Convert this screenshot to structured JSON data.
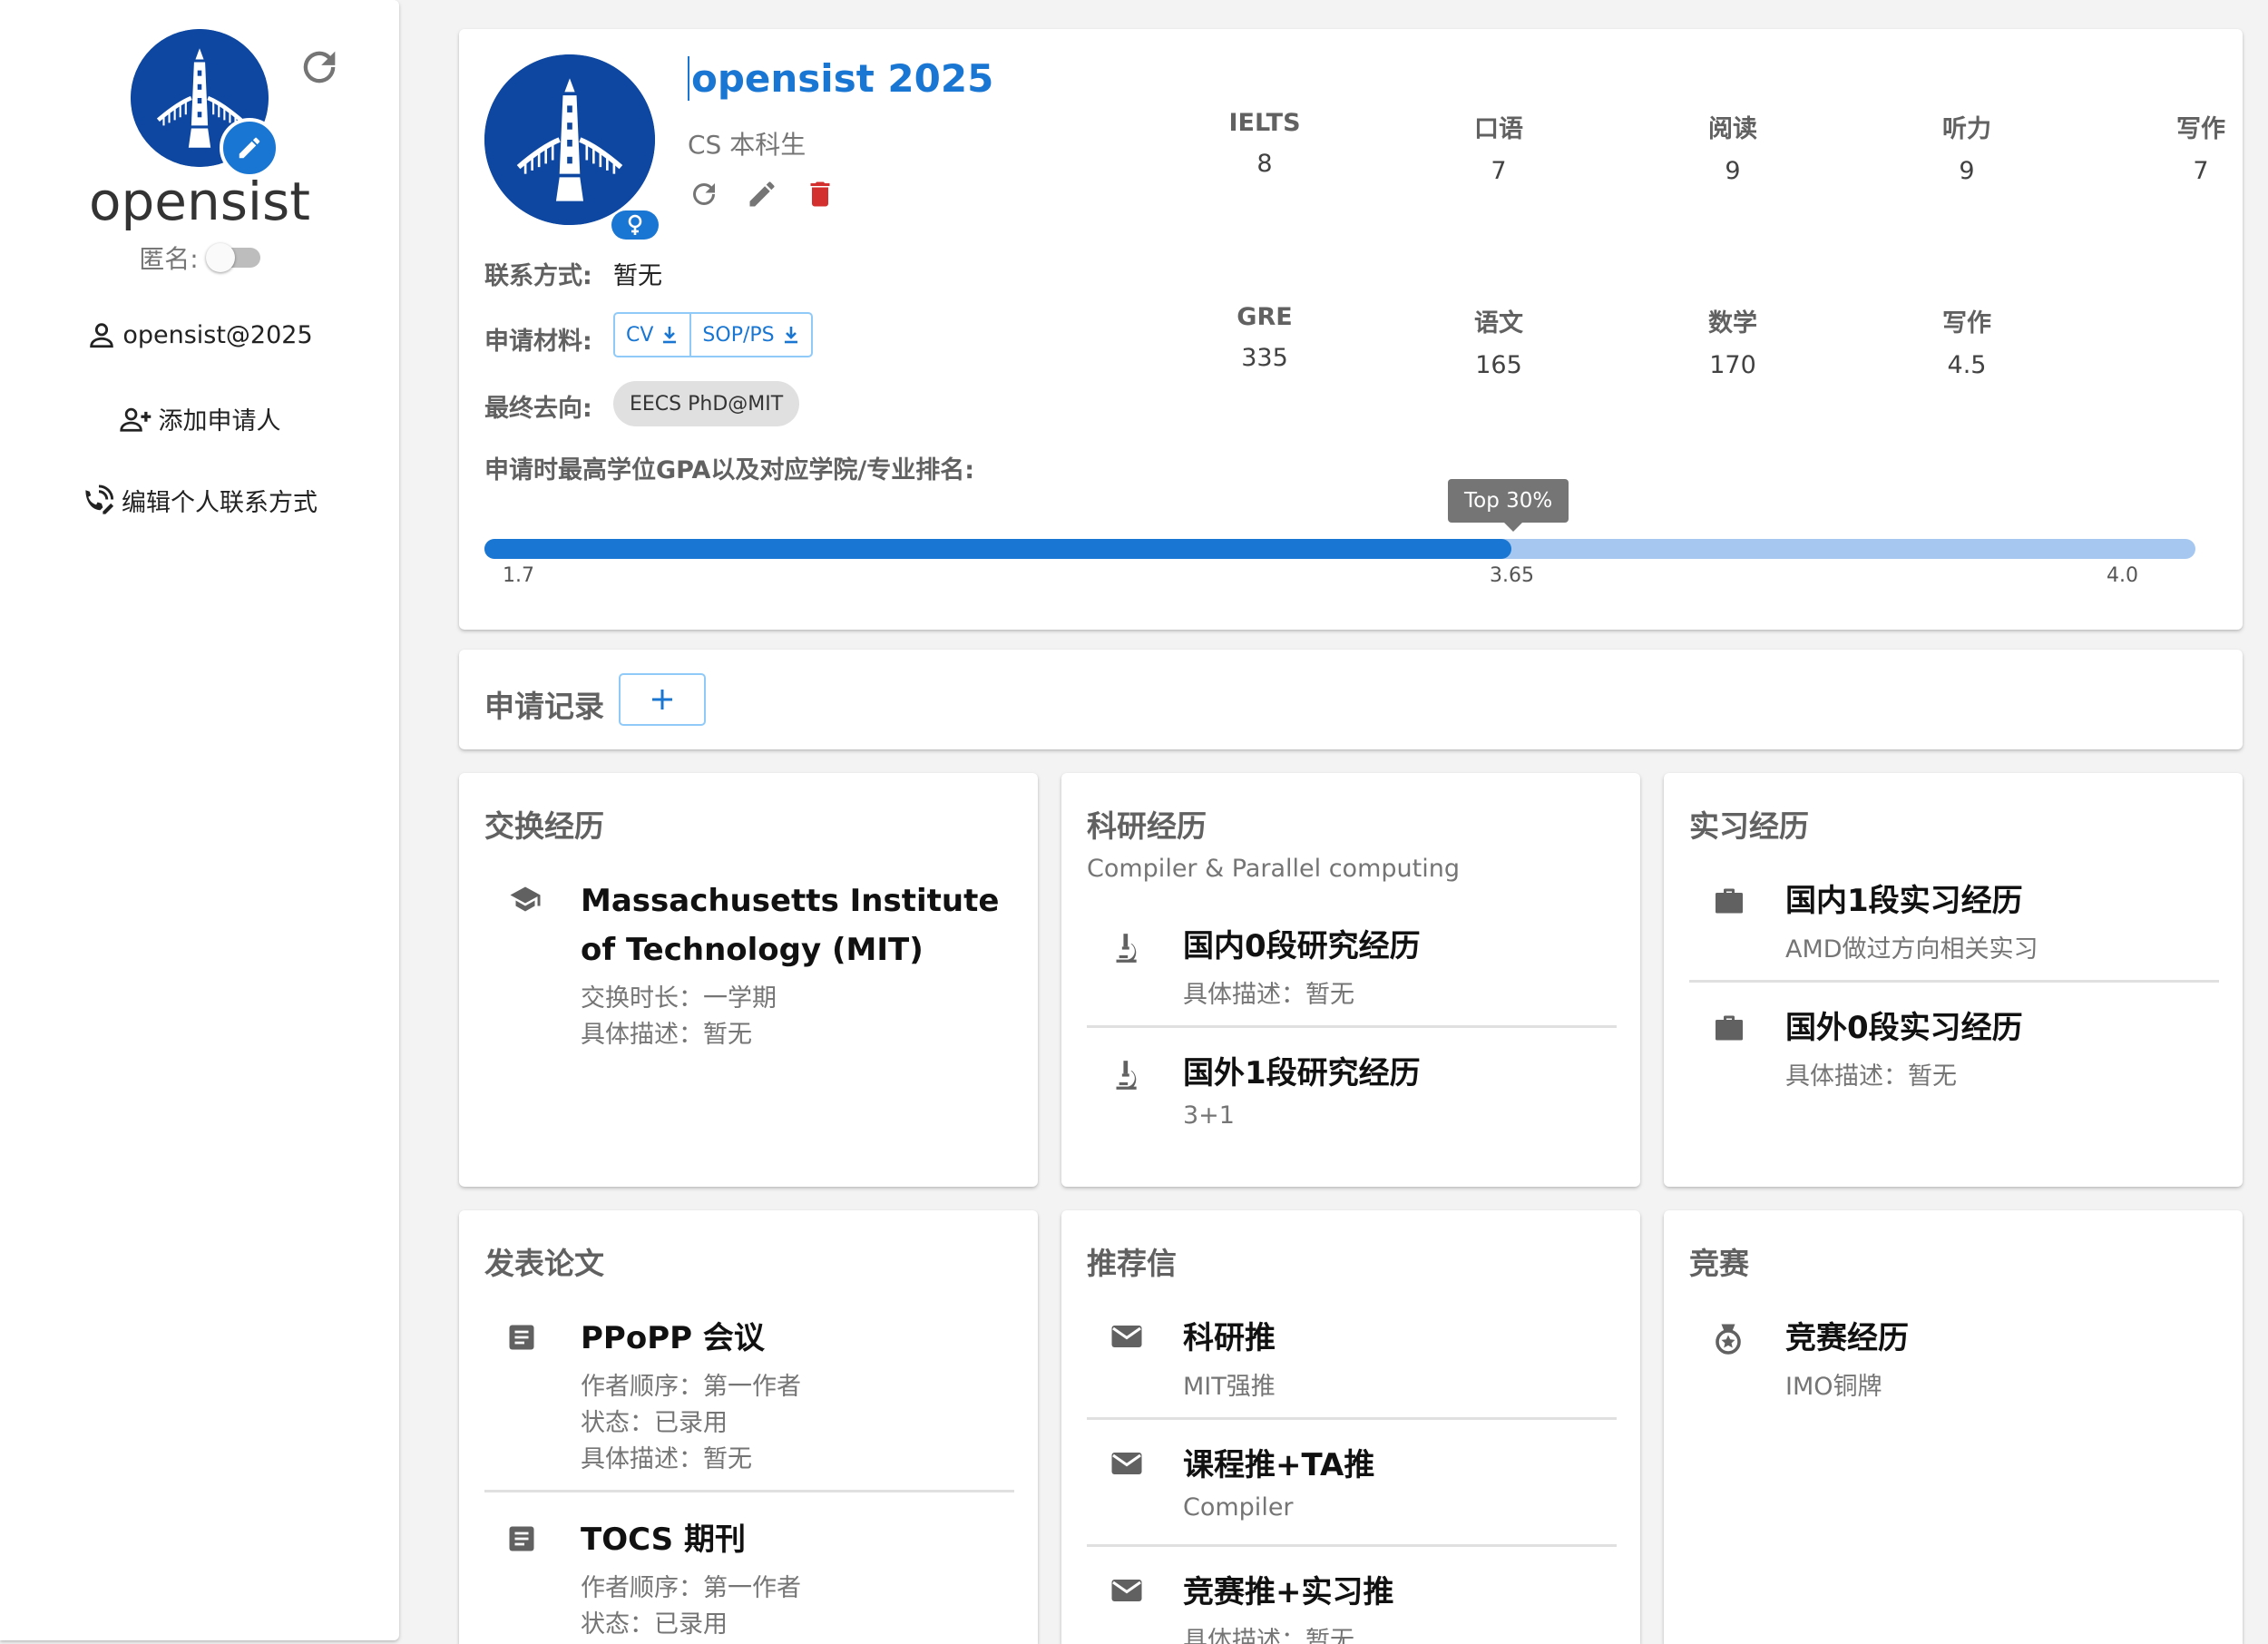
{
  "sidebar": {
    "name": "opensist",
    "anon_label": "匿名:",
    "user_link": "opensist@2025",
    "add_applicant": "添加申请人",
    "edit_contact": "编辑个人联系方式"
  },
  "profile": {
    "title": "opensist 2025",
    "subtitle": "CS 本科生",
    "ielts": [
      {
        "label": "IELTS",
        "value": "8"
      },
      {
        "label": "口语",
        "value": "7"
      },
      {
        "label": "阅读",
        "value": "9"
      },
      {
        "label": "听力",
        "value": "9"
      },
      {
        "label": "写作",
        "value": "7"
      }
    ],
    "gre": [
      {
        "label": "GRE",
        "value": "335"
      },
      {
        "label": "语文",
        "value": "165"
      },
      {
        "label": "数学",
        "value": "170"
      },
      {
        "label": "写作",
        "value": "4.5"
      }
    ],
    "contact_label": "联系方式:",
    "contact_value": "暂无",
    "materials_label": "申请材料:",
    "materials": [
      "CV",
      "SOP/PS"
    ],
    "destination_label": "最终去向:",
    "destination": "EECS PhD@MIT",
    "gpa_title": "申请时最高学位GPA以及对应学院/专业排名:",
    "gpa_tooltip": "Top 30%",
    "gpa_min": "1.7",
    "gpa_value": "3.65",
    "gpa_max": "4.0",
    "gpa_fraction": 0.6
  },
  "records": {
    "title": "申请记录",
    "add_symbol": "+"
  },
  "exchange": {
    "title": "交换经历",
    "items": [
      {
        "title": "Massachusetts Institute of Technology (MIT)",
        "lines": [
          "交换时长：一学期",
          "具体描述：暂无"
        ]
      }
    ]
  },
  "research": {
    "title": "科研经历",
    "subtitle": "Compiler & Parallel computing",
    "items": [
      {
        "title": "国内0段研究经历",
        "lines": [
          "具体描述：暂无"
        ]
      },
      {
        "title": "国外1段研究经历",
        "lines": [
          "3+1"
        ]
      }
    ]
  },
  "internship": {
    "title": "实习经历",
    "items": [
      {
        "title": "国内1段实习经历",
        "lines": [
          "AMD做过方向相关实习"
        ]
      },
      {
        "title": "国外0段实习经历",
        "lines": [
          "具体描述：暂无"
        ]
      }
    ]
  },
  "papers": {
    "title": "发表论文",
    "items": [
      {
        "title": "PPoPP 会议",
        "lines": [
          "作者顺序：第一作者",
          "状态：已录用",
          "具体描述：暂无"
        ]
      },
      {
        "title": "TOCS 期刊",
        "lines": [
          "作者顺序：第一作者",
          "状态：已录用"
        ]
      }
    ]
  },
  "recommendations": {
    "title": "推荐信",
    "items": [
      {
        "title": "科研推",
        "lines": [
          "MIT强推"
        ]
      },
      {
        "title": "课程推+TA推",
        "lines": [
          "Compiler"
        ]
      },
      {
        "title": "竞赛推+实习推",
        "lines": [
          "具体描述：暂无"
        ]
      }
    ]
  },
  "competitions": {
    "title": "竞赛",
    "items": [
      {
        "title": "竞赛经历",
        "lines": [
          "IMO铜牌"
        ]
      }
    ]
  },
  "colors": {
    "accent": "#1976d2",
    "danger": "#d32f2f",
    "avatar_bg": "#0d47a1",
    "track_light": "#a6c8f0"
  },
  "icons": {
    "refresh": "refresh-icon",
    "edit": "pencil-icon",
    "delete": "trash-icon",
    "gender": "female-icon",
    "user": "user-icon",
    "add_user": "add-user-icon",
    "contact": "contact-edit-icon",
    "download": "download-icon",
    "school": "school-icon",
    "research": "microscope-icon",
    "work": "briefcase-icon",
    "paper": "document-icon",
    "mail": "mail-icon",
    "medal": "medal-icon"
  }
}
